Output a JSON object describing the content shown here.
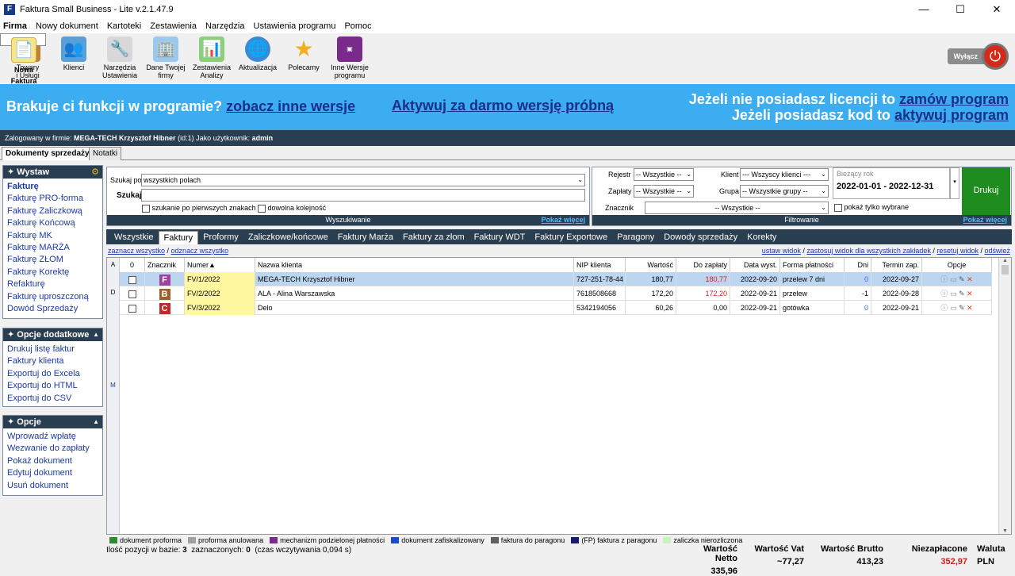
{
  "app": {
    "title": "Faktura Small Business - Lite v.2.1.47.9",
    "icon_letter": "F"
  },
  "menu": [
    "Firma",
    "Nowy dokument",
    "Kartoteki",
    "Zestawienia",
    "Narzędzia",
    "Ustawienia programu",
    "Pomoc"
  ],
  "toolbar": [
    {
      "line1": "Nowa",
      "line2": "Faktura",
      "icon": "new-invoice-icon"
    },
    {
      "line1": "Towary",
      "line2": "i Usługi",
      "icon": "boxes-icon"
    },
    {
      "line1": "Klienci",
      "line2": "",
      "icon": "clients-icon"
    },
    {
      "line1": "Narzędzia",
      "line2": "Ustawienia",
      "icon": "tools-icon"
    },
    {
      "line1": "Dane Twojej",
      "line2": "firmy",
      "icon": "company-icon"
    },
    {
      "line1": "Zestawienia",
      "line2": "Analizy",
      "icon": "charts-icon"
    },
    {
      "line1": "Aktualizacja",
      "line2": "",
      "icon": "globe-icon"
    },
    {
      "line1": "Polecamy",
      "line2": "",
      "icon": "star-icon"
    },
    {
      "line1": "Inne Wersje",
      "line2": "programu",
      "icon": "versions-icon"
    }
  ],
  "power_label": "Wyłącz",
  "banner": {
    "left_text": "Brakuje ci funkcji w programie?",
    "left_link": "zobacz inne wersje",
    "center_link": "Aktywuj  za darmo  wersję próbną",
    "right1_text": "Jeżeli nie posiadasz licencji to",
    "right1_link": "zamów program",
    "right2_text": "Jeżeli posiadasz kod to",
    "right2_link": "aktywuj program"
  },
  "login": {
    "prefix": "Zalogowany w firmie:",
    "company": "MEGA-TECH Krzysztof Hibner",
    "id": "(id:1) Jako użytkownik:",
    "user": "admin"
  },
  "doc_tabs": [
    "Dokumenty sprzedaży",
    "Notatki"
  ],
  "panel_wystaw": {
    "title": "Wystaw",
    "items": [
      "Fakturę",
      "Fakturę PRO-forma",
      "Fakturę Zaliczkową",
      "Fakturę Końcową",
      "Fakturę MK",
      "Fakturę MARŻA",
      "Fakturę ZŁOM",
      "Fakturę Korektę",
      "Refakturę",
      "Fakturę uproszczoną",
      "Dowód Sprzedaży"
    ]
  },
  "panel_opcje_dod": {
    "title": "Opcje dodatkowe",
    "items": [
      "Drukuj listę faktur",
      "Faktury klienta",
      "Exportuj do Excela",
      "Exportuj do HTML",
      "Exportuj do CSV"
    ]
  },
  "panel_opcje": {
    "title": "Opcje",
    "items": [
      "Wprowadź wpłatę",
      "Wezwanie do zapłaty",
      "Pokaż dokument",
      "Edytuj dokument",
      "Usuń dokument"
    ]
  },
  "search": {
    "search_by_label": "Szukaj po",
    "search_by_value": "wszystkich polach",
    "search_label": "Szukaj",
    "search_value": "",
    "opt1": "szukanie po pierwszych znakach",
    "opt2": "dowolna kolejność",
    "footer": "Wyszukiwanie",
    "show_more": "Pokaż więcej"
  },
  "filter": {
    "rejestr_label": "Rejestr",
    "rejestr_value": "-- Wszystkie --",
    "zaplaty_label": "Zapłaty",
    "zaplaty_value": "-- Wszystkie --",
    "znacznik_label": "Znacznik",
    "znacznik_value": "-- Wszystkie --",
    "klient_label": "Klient",
    "klient_value": "--- Wszyscy klienci ---",
    "grupa_label": "Grupa",
    "grupa_value": "-- Wszystkie grupy --",
    "period_label": "Bieżący rok",
    "period_value": "2022-01-01  -  2022-12-31",
    "only_selected": "pokaż tylko wybrane",
    "print": "Drukuj",
    "footer": "Filtrowanie",
    "show_more": "Pokaż więcej"
  },
  "grid_tabs": [
    "Wszystkie",
    "Faktury",
    "Proformy",
    "Zaliczkowe/końcowe",
    "Faktury Marża",
    "Faktury za złom",
    "Faktury WDT",
    "Faktury Exportowe",
    "Paragony",
    "Dowody sprzedaży",
    "Korekty"
  ],
  "links": {
    "select_all": "zaznacz wszystko",
    "deselect_all": "odznacz wszystko",
    "set_view": "ustaw widok",
    "apply_view": "zastosuj widok dla wszystkich zakładek",
    "reset_view": "resetuj widok",
    "refresh": "odśwież"
  },
  "columns": [
    "0",
    "Znacznik",
    "Numer",
    "Nazwa klienta",
    "NIP klienta",
    "Wartość",
    "Do zapłaty",
    "Data wyst.",
    "Forma płatności",
    "Dni",
    "Termin zap.",
    "Opcje"
  ],
  "sort_arrow": "▲",
  "az_letters": [
    "A",
    "D",
    "M"
  ],
  "rows": [
    {
      "mark": "F",
      "mark_color": "#a040a0",
      "number": "FV/1/2022",
      "client": "MEGA-TECH Krzysztof Hibner",
      "nip": "727-251-78-44",
      "value": "180,77",
      "due": "180,77",
      "date": "2022-09-20",
      "payment": "przelew 7 dni",
      "days": "0",
      "term": "2022-09-27"
    },
    {
      "mark": "B",
      "mark_color": "#a0602a",
      "number": "FV/2/2022",
      "client": "ALA - Alina Warszawska",
      "nip": "7618508668",
      "value": "172,20",
      "due": "172,20",
      "date": "2022-09-21",
      "payment": "przelew",
      "days": "-1",
      "term": "2022-09-28"
    },
    {
      "mark": "C",
      "mark_color": "#c02a2a",
      "number": "FV/3/2022",
      "client": "Delo",
      "nip": "5342194056",
      "value": "60,26",
      "due": "0,00",
      "date": "2022-09-21",
      "payment": "gotówka",
      "days": "0",
      "term": "2022-09-21"
    }
  ],
  "legend": [
    {
      "label": "dokument proforma",
      "color": "#2e8b2e"
    },
    {
      "label": "proforma anulowana",
      "color": "#a0a0a0"
    },
    {
      "label": "mechanizm podzielonej płatności",
      "color": "#7a2a8a"
    },
    {
      "label": "dokument zafiskalizowany",
      "color": "#1a4ad0"
    },
    {
      "label": "faktura do paragonu",
      "color": "#606060"
    },
    {
      "label": "(FP) faktura z paragonu",
      "color": "#1a1a6a"
    },
    {
      "label": "zaliczka nierozliczona",
      "color": "#c8f0c0"
    }
  ],
  "footer": {
    "count_label": "Ilość pozycji w bazie:",
    "count": "3",
    "selected_label": "zaznaczonych:",
    "selected": "0",
    "time": "(czas wczytywania 0,094 s)"
  },
  "totals": [
    {
      "label": "Wartość Netto",
      "value": "335,96"
    },
    {
      "label": "Wartość Vat",
      "value": "~77,27"
    },
    {
      "label": "Wartość Brutto",
      "value": "413,23"
    },
    {
      "label": "Niezapłacone",
      "value": "352,97"
    },
    {
      "label": "Waluta",
      "value": "PLN"
    }
  ]
}
